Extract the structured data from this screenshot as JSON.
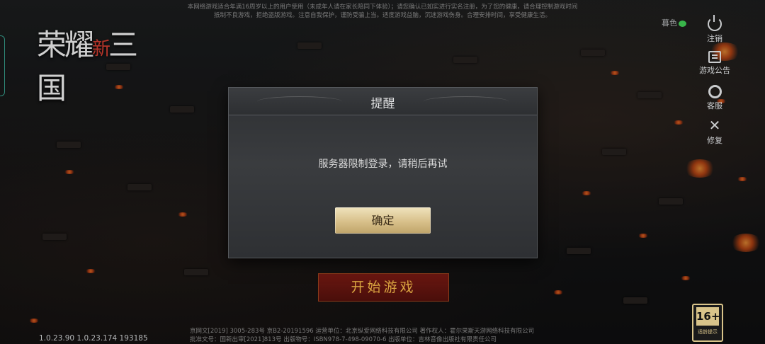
{
  "notice": {
    "line1": "本网络游戏适合年满16周岁以上的用户使用（未成年人请在家长陪同下体验）；请您确认已如实进行实名注册，为了您的健康，请合理控制游戏时间",
    "line2": "抵制不良游戏，拒绝盗版游戏。注意自我保护，谨防受骗上当。适度游戏益脑，沉迷游戏伤身。合理安排时间，享受健康生活。"
  },
  "logo": {
    "part1": "荣耀",
    "part2": "新",
    "part3": "三国"
  },
  "wechat_label": "暮色",
  "side_menu": [
    {
      "label": "注销",
      "icon": "power-icon"
    },
    {
      "label": "游戏公告",
      "icon": "notice-board-icon"
    },
    {
      "label": "客服",
      "icon": "customer-service-icon"
    },
    {
      "label": "修复",
      "icon": "repair-tools-icon"
    }
  ],
  "dialog": {
    "title": "提醒",
    "message": "服务器限制登录，请稍后再试",
    "confirm_label": "确定"
  },
  "start_button": "开始游戏",
  "version": "1.0.23.90 1.0.23.174 193185",
  "footer": {
    "line1": "京网文[2019] 3005-283号 京B2-20191596 运营单位：北京纵爱网络科技有限公司 著作权人：霍尔果斯天游网络科技有限公司",
    "line2": "批准文号：国新出审[2021]813号 出版物号：ISBN978-7-498-09070-6 出版单位：吉林音像出版社有限责任公司"
  },
  "age_rating": {
    "value": "16+",
    "label": "适龄提示"
  },
  "colors": {
    "confirm_gold": "#d8c08a",
    "start_red": "#6a1711",
    "start_text": "#d9a441"
  }
}
